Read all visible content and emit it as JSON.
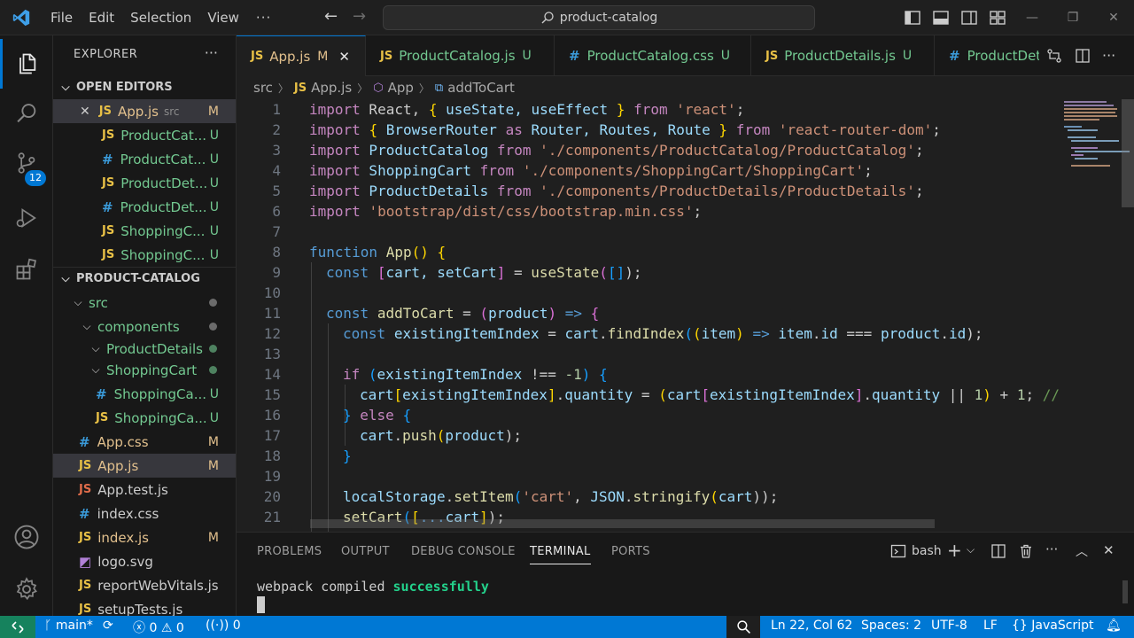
{
  "menu": [
    "File",
    "Edit",
    "Selection",
    "View"
  ],
  "search_text": "product-catalog",
  "explorer": {
    "title": "EXPLORER",
    "open_editors_label": "OPEN EDITORS",
    "open_editors": [
      {
        "name": "App.js",
        "hint": "src",
        "status": "M",
        "type": "js"
      },
      {
        "name": "ProductCat...",
        "status": "U",
        "type": "js"
      },
      {
        "name": "ProductCat...",
        "status": "U",
        "type": "css"
      },
      {
        "name": "ProductDet...",
        "status": "U",
        "type": "js"
      },
      {
        "name": "ProductDet...",
        "status": "U",
        "type": "css"
      },
      {
        "name": "ShoppingC...",
        "status": "U",
        "type": "js"
      },
      {
        "name": "ShoppingC...",
        "status": "U",
        "type": "js"
      }
    ],
    "project_label": "PRODUCT-CATALOG",
    "tree": [
      {
        "name": "src",
        "kind": "folder"
      },
      {
        "name": "components",
        "kind": "folder"
      },
      {
        "name": "ProductDetails",
        "kind": "folder"
      },
      {
        "name": "ShoppingCart",
        "kind": "folder"
      },
      {
        "name": "ShoppingCa...",
        "status": "U",
        "type": "css"
      },
      {
        "name": "ShoppingCa...",
        "status": "U",
        "type": "js"
      },
      {
        "name": "App.css",
        "status": "M",
        "type": "css"
      },
      {
        "name": "App.js",
        "status": "M",
        "type": "js"
      },
      {
        "name": "App.test.js",
        "status": "",
        "type": "js"
      },
      {
        "name": "index.css",
        "status": "",
        "type": "css"
      },
      {
        "name": "index.js",
        "status": "M",
        "type": "js"
      },
      {
        "name": "logo.svg",
        "status": "",
        "type": "svg"
      },
      {
        "name": "reportWebVitals.js",
        "status": "",
        "type": "js"
      },
      {
        "name": "setupTests.js",
        "status": "",
        "type": "js"
      }
    ]
  },
  "scm_badge": "12",
  "tabs": [
    {
      "name": "App.js",
      "status": "M",
      "type": "js"
    },
    {
      "name": "ProductCatalog.js",
      "status": "U",
      "type": "js"
    },
    {
      "name": "ProductCatalog.css",
      "status": "U",
      "type": "css"
    },
    {
      "name": "ProductDetails.js",
      "status": "U",
      "type": "js"
    },
    {
      "name": "ProductDet",
      "status": "",
      "type": "css"
    }
  ],
  "breadcrumb": [
    "src",
    "App.js",
    "App",
    "addToCart"
  ],
  "code_lines": [
    "1",
    "2",
    "3",
    "4",
    "5",
    "6",
    "7",
    "8",
    "9",
    "10",
    "11",
    "12",
    "13",
    "14",
    "15",
    "16",
    "17",
    "18",
    "19",
    "20",
    "21"
  ],
  "code": {
    "l1": [
      "import",
      " React, ",
      "{",
      " useState, useEffect ",
      "}",
      " ",
      "from",
      " ",
      "'react'",
      ";"
    ],
    "l2": [
      "import",
      " ",
      "{",
      " BrowserRouter ",
      "as",
      " Router, Routes, Route ",
      "}",
      " ",
      "from",
      " ",
      "'react-router-dom'",
      ";"
    ],
    "l3": [
      "import",
      " ProductCatalog ",
      "from",
      " ",
      "'./components/ProductCatalog/ProductCatalog'",
      ";"
    ],
    "l4": [
      "import",
      " ShoppingCart ",
      "from",
      " ",
      "'./components/ShoppingCart/ShoppingCart'",
      ";"
    ],
    "l5": [
      "import",
      " ProductDetails ",
      "from",
      " ",
      "'./components/ProductDetails/ProductDetails'",
      ";"
    ],
    "l6": [
      "import",
      " ",
      "'bootstrap/dist/css/bootstrap.min.css'",
      ";"
    ],
    "l8": [
      "function",
      " ",
      "App",
      "()",
      " ",
      "{"
    ],
    "l9": [
      "const",
      " ",
      "[",
      "cart, setCart",
      "]",
      " = ",
      "useState",
      "(",
      "[]",
      ");"
    ],
    "l11": [
      "const",
      " ",
      "addToCart",
      " = ",
      "(",
      "product",
      ")",
      " => ",
      "{"
    ],
    "l12": [
      "const",
      " ",
      "existingItemIndex",
      " = ",
      "cart",
      ".",
      "findIndex",
      "(",
      "(",
      "item",
      ")",
      " => ",
      "item",
      ".",
      "id",
      " === ",
      "product",
      ".",
      "id",
      ");"
    ],
    "l14": [
      "if",
      " ",
      "(",
      "existingItemIndex",
      " !== ",
      "-1",
      ")",
      " ",
      "{"
    ],
    "l15": [
      "cart",
      "[",
      "existingItemIndex",
      "]",
      ".",
      "quantity",
      " = ",
      "(",
      "cart",
      "[",
      "existingItemIndex",
      "]",
      ".",
      "quantity",
      " || ",
      "1",
      ")",
      " + ",
      "1",
      "; ",
      "// U"
    ],
    "l16": [
      "}",
      " ",
      "else",
      " ",
      "{"
    ],
    "l17": [
      "cart",
      ".",
      "push",
      "(",
      "product",
      ");"
    ],
    "l18": [
      "}"
    ],
    "l20": [
      "localStorage",
      ".",
      "setItem",
      "(",
      "'cart'",
      ", ",
      "JSON",
      ".",
      "stringify",
      "(",
      "cart",
      "));"
    ],
    "l21": [
      "setCart",
      "(",
      "[",
      "...",
      "cart",
      "]",
      ");"
    ]
  },
  "panel": {
    "tabs": [
      "PROBLEMS",
      "OUTPUT",
      "DEBUG CONSOLE",
      "TERMINAL",
      "PORTS"
    ],
    "active": "TERMINAL",
    "shell": "bash",
    "output_prefix": "webpack compiled ",
    "output_status": "successfully"
  },
  "status": {
    "branch": "main*",
    "errors": "0",
    "warnings": "0",
    "ports": "0",
    "position": "Ln 22, Col 62",
    "spaces": "Spaces: 2",
    "encoding": "UTF-8",
    "eol": "LF",
    "language": "JavaScript"
  },
  "colors": {
    "accent": "#0078d4",
    "modified": "#e2c08d",
    "untracked": "#73c991",
    "remote": "#16825d"
  }
}
